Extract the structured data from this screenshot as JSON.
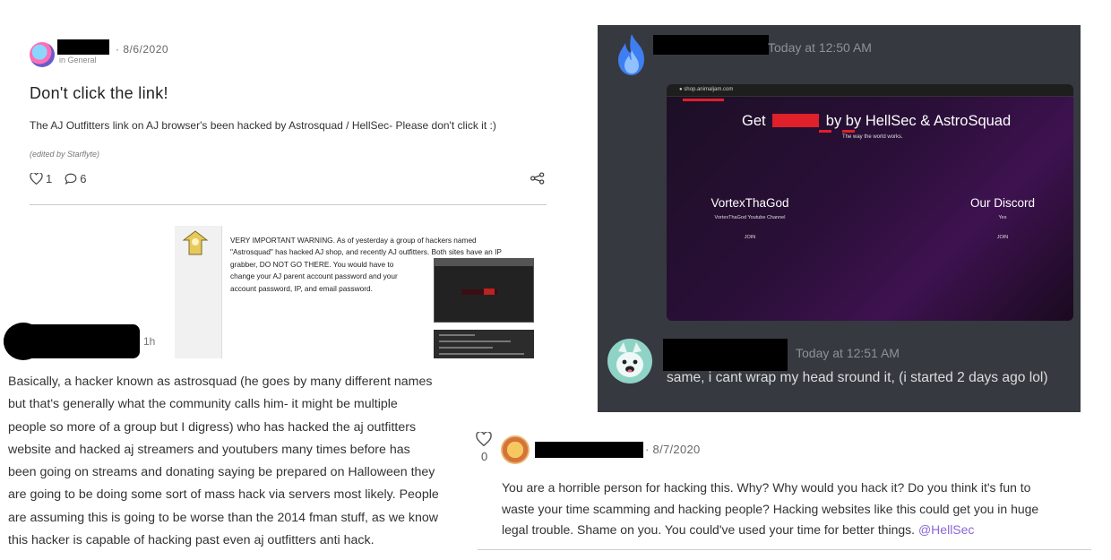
{
  "post1": {
    "date": "· 8/6/2020",
    "category": "in General",
    "title": "Don't click the link!",
    "body": "The AJ Outfitters link on AJ browser's been hacked by Astrosquad / HellSec- Please don't click it :)",
    "edited": "(edited by Starflyte)",
    "likes": "1",
    "comments": "6",
    "icons": [
      "heart-icon",
      "comment-icon",
      "share-icon"
    ]
  },
  "warning": {
    "lines": [
      "VERY IMPORTANT WARNING. As of yesterday a group of hackers named",
      "\"Astrosquad\" has hacked AJ shop, and recently AJ outfitters. Both sites have an IP",
      "grabber, DO NOT GO THERE. You would have to",
      "change your AJ parent account password and your",
      "account password, IP, and email password."
    ]
  },
  "comment1": {
    "time": "1h",
    "lines": [
      "Basically, a hacker known as astrosquad (he goes by many different names",
      "but that's generally what the community calls him- it might be multiple",
      "people so more of a group but I digress) who has hacked the aj outfitters",
      "website and hacked aj streamers and youtubers many times before has",
      "been going on streams and donating saying be prepared on Halloween they",
      "are going to be doing some sort of mass hack  via servers most likely. People",
      "are assuming this is going to be worse than the 2014 fman stuff, as we know",
      "this hacker is capable of hacking past even aj outfitters anti hack."
    ]
  },
  "discord": {
    "time1": "Today at 12:50 AM",
    "site": {
      "url": "shop.animaljam.com",
      "headline_pre": "Get",
      "headline_post": "by by HellSec & AstroSquad",
      "sub": "The way the world works.",
      "col1": {
        "title": "VortexThaGod",
        "sub": "VortexThaGod Youtube Channel",
        "join": "JOIN"
      },
      "col2": {
        "title": "Our Discord",
        "sub": "Yes",
        "join": "JOIN"
      }
    },
    "time2": "Today at 12:51 AM",
    "message": "same, i cant wrap my head sround it, (i started 2 days ago lol)"
  },
  "comment2": {
    "likes": "0",
    "date": "· 8/7/2020",
    "lines": [
      "You are a horrible person for hacking this. Why? Why would you hack it? Do you think it's fun to",
      "waste your time scamming and hacking people? Hacking websites like this could get you in huge",
      "legal trouble. Shame on you. You could've used your time for better things."
    ],
    "mention": "@HellSec"
  }
}
